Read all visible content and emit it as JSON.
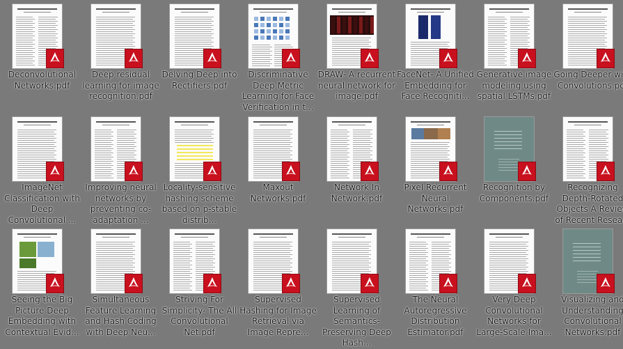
{
  "files": [
    {
      "name": "Deconvolutional Networks.pdf",
      "thumb_title": "Deconvolutional Networks",
      "fig": "none"
    },
    {
      "name": "Deep residual learning for image recognition.pdf",
      "thumb_title": "Deep Residual Learning for Image Recognition",
      "fig": "none"
    },
    {
      "name": "Delving Deep into Rectifiers.pdf",
      "thumb_title": "Delving Deep into Rectifiers",
      "fig": "none"
    },
    {
      "name": "Discriminative Deep Metric Learning for Face Verification in t...",
      "thumb_title": "Discriminative Deep Metric Learning for Face Verification in the Wild",
      "fig": "grid-blue"
    },
    {
      "name": "DRAW- A recurrent neural network for image.pdf",
      "thumb_title": "DRAW: A Recurrent Neural Network For Image Generation",
      "fig": "dark-red"
    },
    {
      "name": "FaceNet- A Unified Embedding for Face Recogniti...",
      "thumb_title": "FaceNet: A Unified Embedding for Face Recognition and Clustering",
      "fig": "blue-faces"
    },
    {
      "name": "Generative image modeling using spatial LSTMs.pdf",
      "thumb_title": "Generative Image Modeling Using Spatial LSTMs",
      "fig": "none"
    },
    {
      "name": "Going Deeper with Convolutions.pdf",
      "thumb_title": "Going deeper with convolutions",
      "fig": "none"
    },
    {
      "name": "ImageNet Classification with Deep Convolutional ...",
      "thumb_title": "ImageNet Classification with Deep Convolutional Neural Networks",
      "fig": "none"
    },
    {
      "name": "Improving neural networks by preventing co-adaptation ...",
      "thumb_title": "Improving neural networks by preventing co-adaptation of feature detectors",
      "fig": "none"
    },
    {
      "name": "Locality-sensitive hashing scheme based on p-stable distrib...",
      "thumb_title": "Locality-Sensitive Hashing Scheme Based on p-Stable Distributions",
      "fig": "yellow"
    },
    {
      "name": "Maxout Networks.pdf",
      "thumb_title": "Maxout Networks",
      "fig": "none"
    },
    {
      "name": "Network In Network.pdf",
      "thumb_title": "Network In Network",
      "fig": "none"
    },
    {
      "name": "Pixel Recurrent Neural Networks.pdf",
      "thumb_title": "Pixel Recurrent Neural Networks",
      "fig": "photo-strip"
    },
    {
      "name": "Recognition by Components.pdf",
      "thumb_title": "",
      "fig": "dark-page"
    },
    {
      "name": "Recognizing Depth-Rotated Objects A Review of Recent Resea...",
      "thumb_title": "Recognizing Depth-Rotated Objects: A Review of Recent Research and Theory",
      "fig": "none"
    },
    {
      "name": "Seeing the Big Picture Deep Embedding with Contextual Evid...",
      "thumb_title": "Seeing the Big Picture: Deep Embedding with Contextual Evidences",
      "fig": "green-photos"
    },
    {
      "name": "Simultaneous Feature Learning and Hash Coding with Deep Neu...",
      "thumb_title": "Simultaneous Feature Learning and Hash Coding with Deep Neural Networks",
      "fig": "none"
    },
    {
      "name": "Striving For Simplicity- The All Convolutional Net.pdf",
      "thumb_title": "Striving for Simplicity: The All Convolutional Net",
      "fig": "none"
    },
    {
      "name": "Supervised Hashing for Image Retrieval via Image Repre...",
      "thumb_title": "Supervised Hashing for Image Retrieval via Image Representation Learning",
      "fig": "none"
    },
    {
      "name": "Supervised Learning of Semantics-Preserving Deep Hash...",
      "thumb_title": "Supervised Learning of Semantics-Preserving Hashing via Deep Neural Networks for Large-Scale Image Search",
      "fig": "none"
    },
    {
      "name": "The Neural Autoregressive Distribution Estimator.pdf",
      "thumb_title": "The Neural Autoregressive Distribution Estimator",
      "fig": "none"
    },
    {
      "name": "Very Deep Convolutional Networks for Large-Scale Ima...",
      "thumb_title": "Very Deep Convolutional Networks for Large-Scale Image Recognition",
      "fig": "none"
    },
    {
      "name": "Visualizing and Understanding Convolutional Networks.pdf",
      "thumb_title": "",
      "fig": "dark-page"
    }
  ],
  "colors": {
    "background": "#7a7a7a",
    "pdf_badge": "#c8101e",
    "label_text": "#1a1a1a"
  },
  "icons": {
    "badge": "adobe-pdf-icon"
  }
}
